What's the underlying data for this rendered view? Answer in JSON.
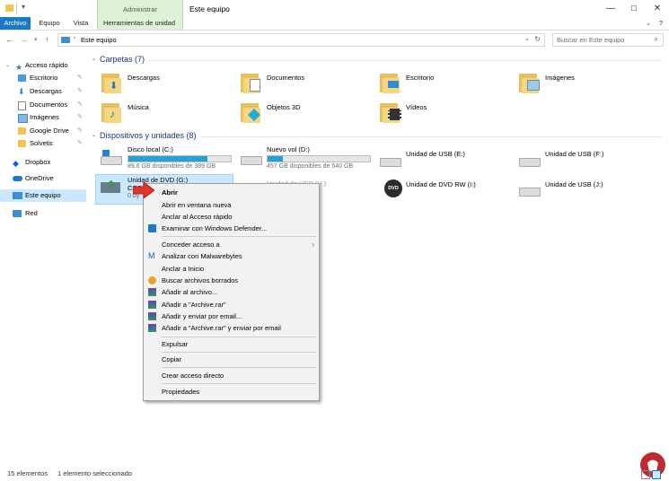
{
  "window": {
    "title": "Este equipo",
    "context_group": "Administrar",
    "controls": {
      "minimize": "—",
      "maximize": "□",
      "close": "✕"
    }
  },
  "ribbon": {
    "tabs": [
      "Archivo",
      "Equipo",
      "Vista",
      "Herramientas de unidad"
    ],
    "expand_icon": "chevron-down-icon",
    "help_icon": "help-icon"
  },
  "address": {
    "path": "Este equipo",
    "search_placeholder": "Buscar en Este equipo"
  },
  "sidebar": {
    "items": [
      {
        "label": "Acceso rápido",
        "icon": "star-icon",
        "pinned": false
      },
      {
        "label": "Escritorio",
        "icon": "desktop-icon",
        "pinned": true
      },
      {
        "label": "Descargas",
        "icon": "download-icon",
        "pinned": true
      },
      {
        "label": "Documentos",
        "icon": "documents-icon",
        "pinned": true
      },
      {
        "label": "Imágenes",
        "icon": "pictures-icon",
        "pinned": true
      },
      {
        "label": "Google Drive",
        "icon": "folder-icon",
        "pinned": true
      },
      {
        "label": "Solvetic",
        "icon": "folder-icon",
        "pinned": true
      },
      {
        "label": "Dropbox",
        "icon": "dropbox-icon",
        "pinned": false
      },
      {
        "label": "OneDrive",
        "icon": "cloud-icon",
        "pinned": false
      },
      {
        "label": "Este equipo",
        "icon": "computer-icon",
        "pinned": false,
        "selected": true
      },
      {
        "label": "Red",
        "icon": "network-icon",
        "pinned": false
      }
    ]
  },
  "folders": {
    "header": "Carpetas (7)",
    "items": [
      "Descargas",
      "Documentos",
      "Escritorio",
      "Imágenes",
      "Música",
      "Objetos 3D",
      "Vídeos"
    ]
  },
  "devices": {
    "header": "Dispositivos y unidades (8)",
    "items": [
      {
        "name": "Disco local (C:)",
        "free": "89,6 GB disponibles de 389 GB",
        "used_fraction": 0.77
      },
      {
        "name": "Nuevo vol (D:)",
        "free": "457 GB disponibles de 540 GB",
        "used_fraction": 0.15
      },
      {
        "name": "Unidad de USB (E:)"
      },
      {
        "name": "Unidad de USB (F:)"
      },
      {
        "name": "Unidad de DVD (G:)",
        "sub": "CCS",
        "free": "0 by",
        "selected": true
      },
      {
        "name": "Unidad de USB (H:)"
      },
      {
        "name": "Unidad de DVD RW (I:)",
        "badge": "DVD"
      },
      {
        "name": "Unidad de USB (J:)"
      }
    ]
  },
  "context_menu": {
    "items": [
      {
        "label": "Abrir",
        "bold": true
      },
      {
        "label": "Abrir en ventana nueva"
      },
      {
        "label": "Anclar al Acceso rápido"
      },
      {
        "label": "Examinar con Windows Defender...",
        "icon": "defender-icon"
      },
      {
        "separator": true
      },
      {
        "label": "Conceder acceso a",
        "submenu": true
      },
      {
        "label": "Analizar con Malwarebytes",
        "icon": "malwarebytes-icon"
      },
      {
        "label": "Anclar a Inicio"
      },
      {
        "label": "Buscar archivos borrados",
        "icon": "recuva-icon"
      },
      {
        "label": "Añadir al archivo...",
        "icon": "winrar-icon"
      },
      {
        "label": "Añadir a \"Archive.rar\"",
        "icon": "winrar-icon"
      },
      {
        "label": "Añadir y enviar por email...",
        "icon": "winrar-icon"
      },
      {
        "label": "Añadir a \"Archive.rar\" y enviar por email",
        "icon": "winrar-icon"
      },
      {
        "separator": true
      },
      {
        "label": "Expulsar"
      },
      {
        "separator": true
      },
      {
        "label": "Copiar"
      },
      {
        "separator": true
      },
      {
        "label": "Crear acceso directo"
      },
      {
        "separator": true
      },
      {
        "label": "Propiedades"
      }
    ]
  },
  "status": {
    "count": "15 elementos",
    "selection": "1 elemento seleccionado"
  },
  "colors": {
    "accent": "#1979ca",
    "selection": "#cce8ff",
    "bar_fill": "#26a0da",
    "context_tab": "#dff2d8",
    "cursor_arrow": "#e0352b"
  }
}
